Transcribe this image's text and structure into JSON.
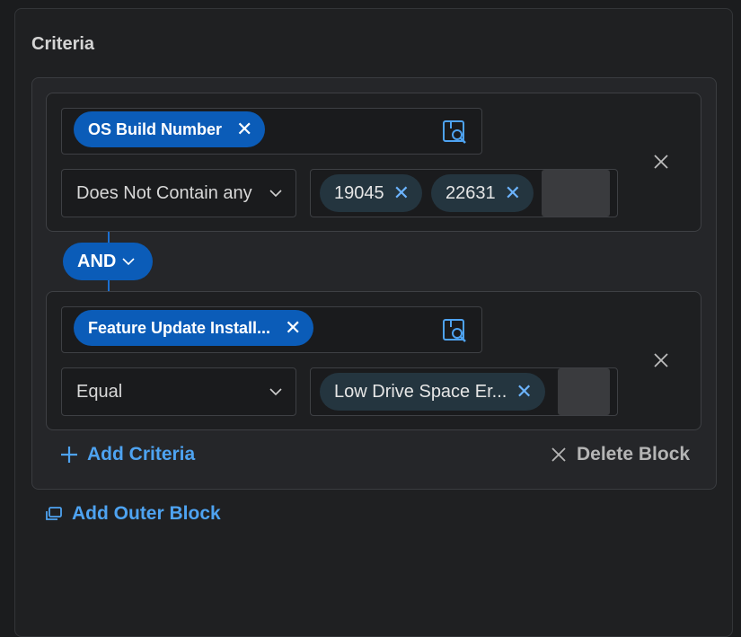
{
  "panel": {
    "title": "Criteria"
  },
  "blocks": [
    {
      "field": "OS Build Number",
      "operator": "Does Not Contain any",
      "values": [
        "19045",
        "22631"
      ]
    },
    {
      "field": "Feature Update Install...",
      "operator": "Equal",
      "values": [
        "Low Drive Space Er..."
      ]
    }
  ],
  "connector": {
    "label": "AND"
  },
  "actions": {
    "add_criteria": "Add Criteria",
    "delete_block": "Delete Block",
    "add_outer_block": "Add Outer Block"
  },
  "colors": {
    "accent": "#0b5cb8",
    "link": "#4ea3f1",
    "background": "#1b1c1e"
  },
  "icons": [
    "remove-chip-icon",
    "field-picker-icon",
    "chevron-down-icon",
    "close-icon",
    "plus-icon",
    "add-block-icon"
  ]
}
